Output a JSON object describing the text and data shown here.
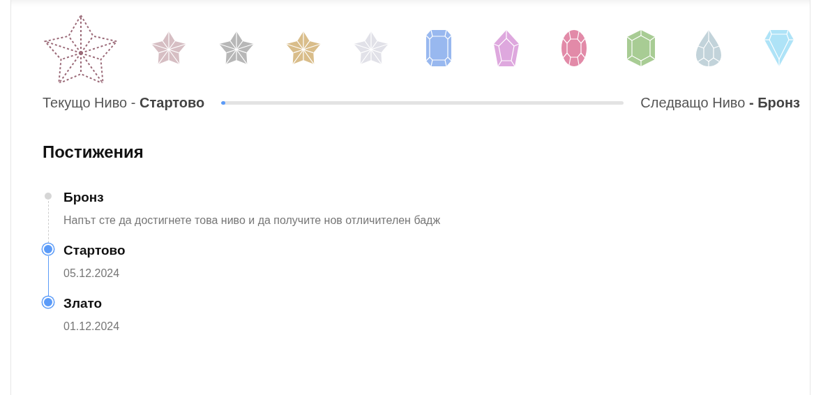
{
  "levels": [
    {
      "kind": "star-outline",
      "color": "#9b6a78",
      "selected": true
    },
    {
      "kind": "star",
      "color": "#d6bec3",
      "selected": false
    },
    {
      "kind": "star",
      "color": "#b7b7b7",
      "selected": false
    },
    {
      "kind": "star",
      "color": "#d9bd8a",
      "selected": false
    },
    {
      "kind": "star",
      "color": "#e1e1e8",
      "selected": false
    },
    {
      "kind": "emerald",
      "color": "#98b8ef",
      "selected": false
    },
    {
      "kind": "pentagon",
      "color": "#dea8de",
      "selected": false
    },
    {
      "kind": "oval",
      "color": "#e28aa8",
      "selected": false
    },
    {
      "kind": "hexagon",
      "color": "#a8cc94",
      "selected": false
    },
    {
      "kind": "pear",
      "color": "#c2d3da",
      "selected": false
    },
    {
      "kind": "diamond",
      "color": "#aee3f7",
      "selected": false
    }
  ],
  "progress": {
    "current": "Текущо Ниво - **Стартово**",
    "level": 0.01,
    "next": "Следващо Ниво **- Бронз**"
  },
  "achievements": {
    "title": "Постижения",
    "items": [
      {
        "title": "Бронз",
        "subtitle": "Напът сте да достигнете това ниво и да получите нов отличителен бадж",
        "achieved": false
      },
      {
        "title": "Стартово",
        "subtitle": "05.12.2024",
        "achieved": true
      },
      {
        "title": "Злато",
        "subtitle": "01.12.2024",
        "achieved": true
      }
    ]
  }
}
